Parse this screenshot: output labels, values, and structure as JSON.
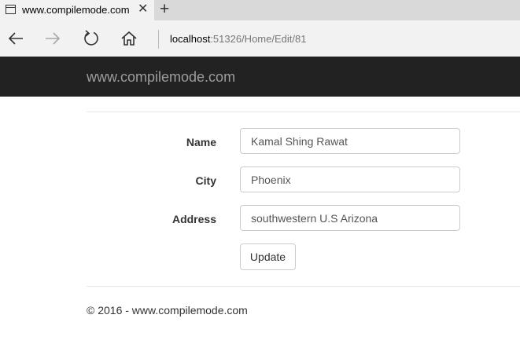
{
  "browser": {
    "tab_title": "www.compilemode.com",
    "tab_close": "✕",
    "new_tab": "+",
    "address_host": "localhost",
    "address_rest": ":51326/Home/Edit/81"
  },
  "site": {
    "brand": "www.compilemode.com"
  },
  "form": {
    "name_label": "Name",
    "name_value": "Kamal Shing Rawat",
    "city_label": "City",
    "city_value": "Phoenix",
    "address_label": "Address",
    "address_value": "southwestern U.S Arizona",
    "submit_label": "Update"
  },
  "footer": {
    "text": "© 2016 - www.compilemode.com"
  }
}
